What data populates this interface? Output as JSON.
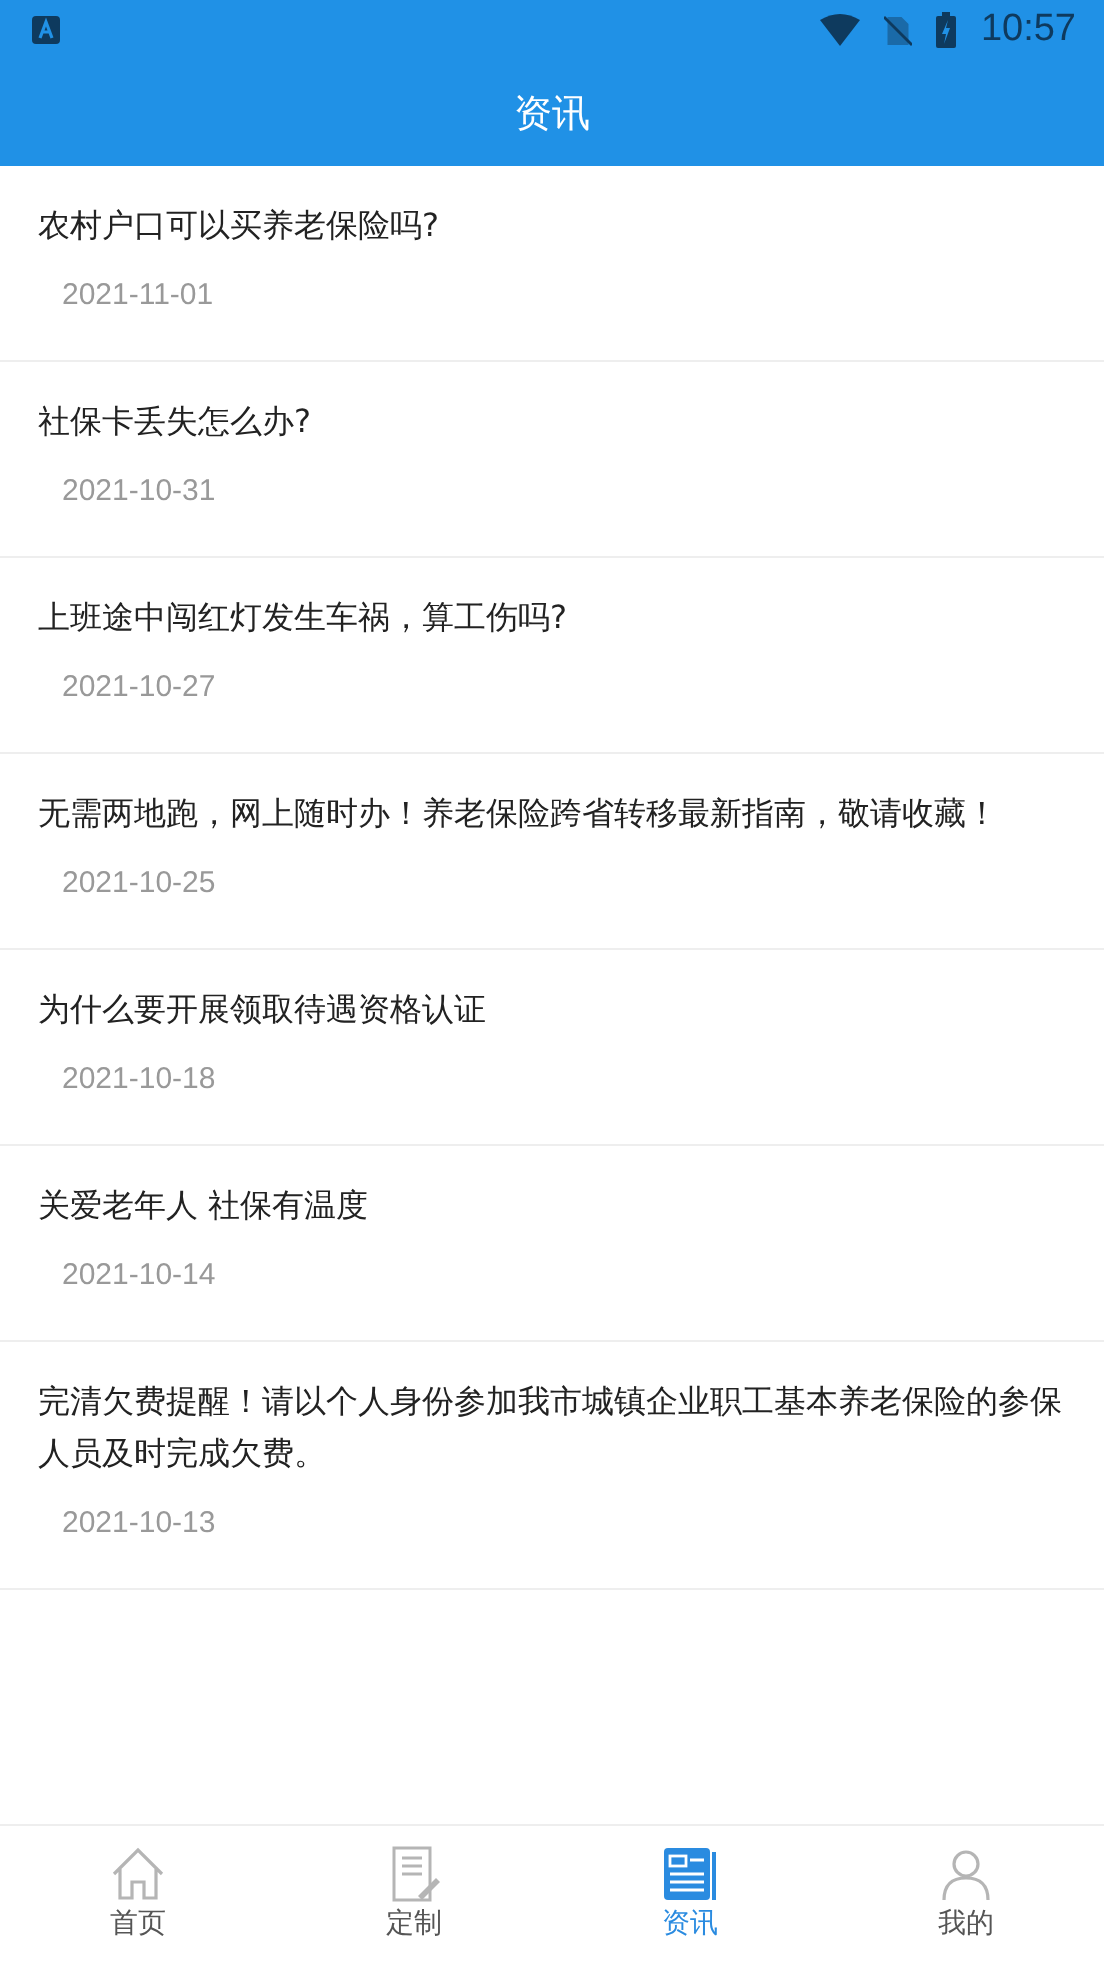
{
  "status_bar": {
    "time": "10:57"
  },
  "header": {
    "title": "资讯"
  },
  "articles": [
    {
      "title": "农村户口可以买养老保险吗?",
      "date": "2021-11-01"
    },
    {
      "title": "社保卡丢失怎么办?",
      "date": "2021-10-31"
    },
    {
      "title": "上班途中闯红灯发生车祸，算工伤吗?",
      "date": "2021-10-27"
    },
    {
      "title": "无需两地跑，网上随时办！养老保险跨省转移最新指南，敬请收藏！",
      "date": "2021-10-25"
    },
    {
      "title": "为什么要开展领取待遇资格认证",
      "date": "2021-10-18"
    },
    {
      "title": "关爱老年人 社保有温度",
      "date": "2021-10-14"
    },
    {
      "title": "完清欠费提醒！请以个人身份参加我市城镇企业职工基本养老保险的参保人员及时完成欠费。",
      "date": "2021-10-13"
    }
  ],
  "tabs": [
    {
      "label": "首页",
      "kind": "home",
      "selected": false
    },
    {
      "label": "定制",
      "kind": "custom",
      "selected": false
    },
    {
      "label": "资讯",
      "kind": "news",
      "selected": true
    },
    {
      "label": "我的",
      "kind": "me",
      "selected": false
    }
  ]
}
